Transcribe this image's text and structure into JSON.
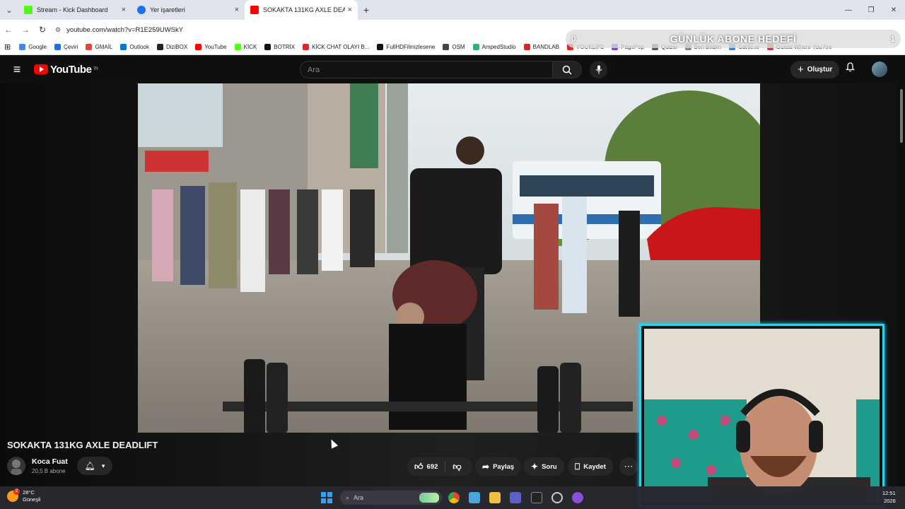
{
  "browser": {
    "tabs": [
      {
        "title": "Stream - Kick Dashboard",
        "favicon_color": "#53fc18"
      },
      {
        "title": "Yer işaretleri",
        "favicon_color": "#1a73e8"
      },
      {
        "title": "SOKAKTA 131KG AXLE DEADLIFT",
        "favicon_color": "#ff0000",
        "active": true
      }
    ],
    "url": "youtube.com/watch?v=R1E259UWSkY",
    "bookmarks": [
      {
        "label": "Google",
        "color": "#4285f4"
      },
      {
        "label": "Çeviri",
        "color": "#1a73e8"
      },
      {
        "label": "GMAİL",
        "color": "#ea4335"
      },
      {
        "label": "Outlook",
        "color": "#0078d4"
      },
      {
        "label": "DiziBOX",
        "color": "#222222"
      },
      {
        "label": "YouTube",
        "color": "#ff0000"
      },
      {
        "label": "KİCK",
        "color": "#53fc18"
      },
      {
        "label": "BOTRİX",
        "color": "#111111"
      },
      {
        "label": "KİCK CHAT OLAYI B...",
        "color": "#d92b2b"
      },
      {
        "label": "FullHDFilmizlesene",
        "color": "#111111"
      },
      {
        "label": "OSM",
        "color": "#444444"
      },
      {
        "label": "AmpedStudio",
        "color": "#2bb673"
      },
      {
        "label": "BANDLAB",
        "color": "#e02424"
      },
      {
        "label": "YOUKLIP2",
        "color": "#e02424"
      },
      {
        "label": "PagePop",
        "color": "#7b3fe4"
      },
      {
        "label": "Quizei",
        "color": "#555555"
      },
      {
        "label": "Ben Bildim",
        "color": "#888888"
      },
      {
        "label": "Gartic.io",
        "color": "#3a7bd5"
      },
      {
        "label": "Guess Where You Are",
        "color": "#cc3344"
      }
    ]
  },
  "goal_overlay": {
    "start": "0",
    "title": "GÜNLÜK ABONE HEDEFİ",
    "end": "1"
  },
  "youtube": {
    "logo": "YouTube",
    "region": "TR",
    "search_placeholder": "Ara",
    "create_label": "Oluştur"
  },
  "video": {
    "title": "SOKAKTA 131KG AXLE DEADLIFT",
    "channel": "Koca Fuat",
    "subscribers": "20,5 B abone",
    "likes": "692",
    "share_label": "Paylaş",
    "ask_label": "Soru",
    "save_label": "Kaydet"
  },
  "taskbar": {
    "temperature": "28°C",
    "weather": "Güneşli",
    "weather_badge": "2",
    "search_placeholder": "Ara",
    "time": "12:51",
    "date": "2026"
  },
  "colors": {
    "accent_cyan": "#33d1e8",
    "youtube_red": "#ff0000"
  }
}
